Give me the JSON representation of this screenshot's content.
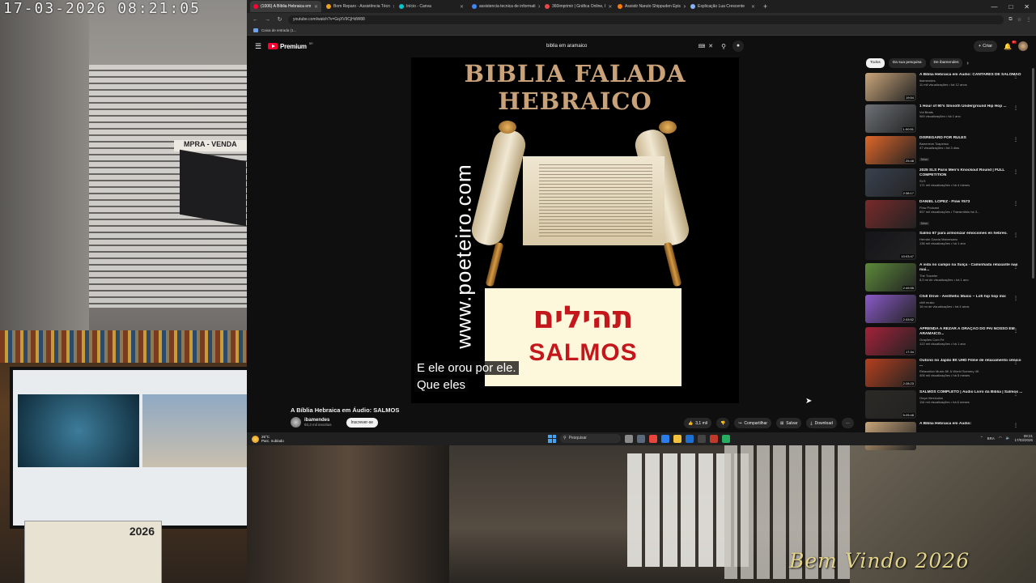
{
  "camera": {
    "timestamp": "17-03-2026 08:21:05",
    "sign_text": "MPRA - VENDA",
    "calendar_year": "2026",
    "welcome_text": "Bem Vindo 2026"
  },
  "browser": {
    "tabs": [
      {
        "label": "(1006) A Bíblia Hebraica em",
        "color": "#ff0033",
        "active": true
      },
      {
        "label": "Bom Reparo - Assistência Técn",
        "color": "#f0a020",
        "active": false
      },
      {
        "label": "Início - Canva",
        "color": "#00c4cc",
        "active": false
      },
      {
        "label": "assistencia tecnica de informati",
        "color": "#4285f4",
        "active": false
      },
      {
        "label": "360imprimir | Gráfica Online, I",
        "color": "#e44",
        "active": false
      },
      {
        "label": "Assistir Naruto Shippuden Epis",
        "color": "#ff7a00",
        "active": false
      },
      {
        "label": "Explicação Lua Crescente",
        "color": "#8ab4f8",
        "active": false
      }
    ],
    "new_tab": "+",
    "url": "youtube.com/watch?v=GqXV9CjHdW88",
    "bookmark": "Caixa de entrada (1...",
    "win_controls": [
      "—",
      "□",
      "✕"
    ]
  },
  "youtube": {
    "logo_text": "Premium",
    "logo_sup": "BR",
    "search_query": "biblia em aramaico",
    "create_label": "Criar",
    "notif_count": "9+",
    "cover": {
      "line1": "BIBLIA FALADA",
      "line2": "HEBRAICO",
      "website": "www.poeteiro.com",
      "hebrew": "תהילים",
      "salmos": "SALMOS"
    },
    "captions": [
      "E ele orou por ele.",
      "Que eles"
    ],
    "video_title": "A Bíblia Hebraica em Áudio: SALMOS",
    "channel_name": "ibamendes",
    "channel_subs": "93,3 mil inscritos",
    "subscribe_label": "Inscrever-se",
    "actions": {
      "likes": "3,1 mil",
      "share": "Compartilhar",
      "save": "Salvar",
      "download": "Download",
      "more": "···"
    },
    "chips": [
      "Todos",
      "Da sua pesquisa",
      "De ibamendes",
      "›"
    ],
    "recommendations": [
      {
        "title": "A Bíblia Hebraica em Áudio: CANTARES DE SALOMÃO",
        "channel": "ibamendes",
        "meta": "11 mil visualizações • há 12 anos",
        "duration": "19:54",
        "badge": "",
        "color": "#c9a57a"
      },
      {
        "title": "1 Hour of 90's Smooth Underground Hip Hop ...",
        "channel": "Vol Beats",
        "meta": "969 visualizações • há 1 ano",
        "duration": "1:00:51",
        "badge": "",
        "color": "#6d7277"
      },
      {
        "title": "DISREGARD FOR RULES",
        "channel": "Валентин Ткаренко",
        "meta": "47 visualizações • há 3 dias",
        "duration": "25:48",
        "badge": "Novo",
        "color": "#e0672a"
      },
      {
        "title": "2025 SLS Paris Men's Knockout Round | FULL COMPETITION",
        "channel": "SLS",
        "meta": "171 mil visualizações • há 4 meses",
        "duration": "2:38:17",
        "badge": "",
        "color": "#3a4250"
      },
      {
        "title": "DANIEL LOPEZ - Flow #573",
        "channel": "Flow Podcast",
        "meta": "557 mil visualizações • Transmitido há 3...",
        "duration": "",
        "badge": "Novo",
        "color": "#7a2a2a"
      },
      {
        "title": "Salmo 67 para armonizar emociones en hebreo.",
        "channel": "Hernán Garcia Manresano",
        "meta": "136 mil visualizações • há 1 ano",
        "duration": "10:03:47",
        "badge": "",
        "color": "#15151a"
      },
      {
        "title": "A vida no campo na Suíça - Caminhada relaxante nas mai...",
        "channel": "The Traveler",
        "meta": "8,5 mi de visualizações • há 1 ano",
        "duration": "2:49:55",
        "badge": "",
        "color": "#5c8a3a"
      },
      {
        "title": "Chill Drive - Aesthetic Music ~ Lofi hip hop mix",
        "channel": "chill music",
        "meta": "16 mi de visualizações • há 4 anos",
        "duration": "2:33:52",
        "badge": "",
        "color": "#8a5ac9"
      },
      {
        "title": "APRENDA A REZAR A ORAÇÃO DO PAI NOSSO EM ARAMAICO...",
        "channel": "Orações Com Fé",
        "meta": "122 mil visualizações • há 1 ano",
        "duration": "17:34",
        "badge": "",
        "color": "#a4223a"
      },
      {
        "title": "Outono no Japão 8K UHD Filme de relaxamento cênico ...",
        "channel": "Relaxation Music 8K & World Scenery 4K",
        "meta": "406 mil visualizações • há 5 meses",
        "duration": "2:28:23",
        "badge": "",
        "color": "#b5401f"
      },
      {
        "title": "SALMOS COMPLETO | Áudio Livro da Bíblia | Salmos ...",
        "channel": "Ouça Versículos",
        "meta": "116 mil visualizações • há 6 meses",
        "duration": "5:25:48",
        "badge": "",
        "color": "#2c2a25"
      },
      {
        "title": "A Bíblia Hebraica em Áudio:",
        "channel": "",
        "meta": "",
        "duration": "",
        "badge": "",
        "color": "#c9a57a"
      }
    ]
  },
  "taskbar": {
    "weather_temp": "25°C",
    "weather_desc": "Parc. nublado",
    "search_label": "Pesquisar",
    "lang": "BRA",
    "time": "08:21",
    "date": "17/03/2026"
  }
}
